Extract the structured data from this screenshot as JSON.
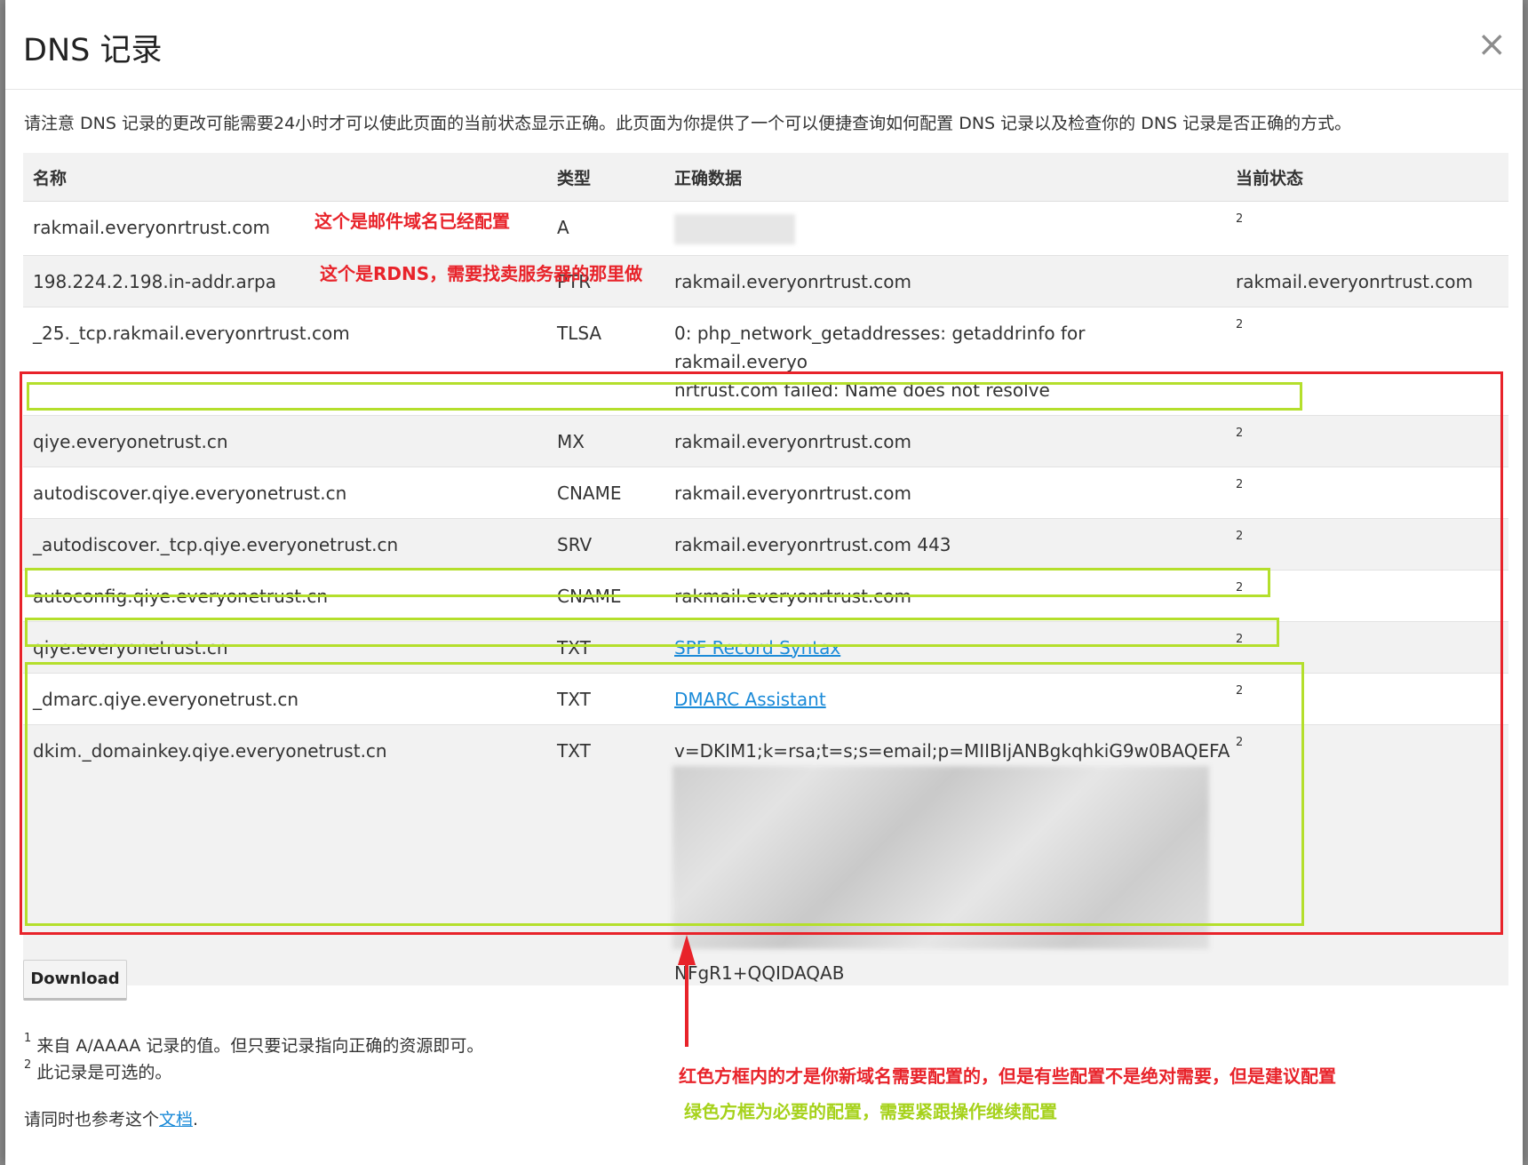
{
  "modal": {
    "title": "DNS 记录",
    "close_glyph": "×",
    "notice": "请注意 DNS 记录的更改可能需要24小时才可以使此页面的当前状态显示正确。此页面为你提供了一个可以便捷查询如何配置 DNS 记录以及检查你的 DNS 记录是否正确的方式。"
  },
  "table": {
    "headers": {
      "name": "名称",
      "type": "类型",
      "data": "正确数据",
      "status": "当前状态"
    },
    "rows": [
      {
        "name": "rakmail.everyonrtrust.com",
        "type": "A",
        "data": "",
        "status": "2"
      },
      {
        "name": "198.224.2.198.in-addr.arpa",
        "type": "PTR",
        "data": "rakmail.everyonrtrust.com",
        "status": "rakmail.everyonrtrust.com"
      },
      {
        "name": "_25._tcp.rakmail.everyonrtrust.com",
        "type": "TLSA",
        "data": "0: php_network_getaddresses: getaddrinfo for rakmail.everyo",
        "data2": "nrtrust.com failed: Name does not resolve",
        "status": "2"
      },
      {
        "name": "qiye.everyonetrust.cn",
        "type": "MX",
        "data": "rakmail.everyonrtrust.com",
        "status": "2"
      },
      {
        "name": "autodiscover.qiye.everyonetrust.cn",
        "type": "CNAME",
        "data": "rakmail.everyonrtrust.com",
        "status": "2"
      },
      {
        "name": "_autodiscover._tcp.qiye.everyonetrust.cn",
        "type": "SRV",
        "data": "rakmail.everyonrtrust.com 443",
        "status": "2"
      },
      {
        "name": "autoconfig.qiye.everyonetrust.cn",
        "type": "CNAME",
        "data": "rakmail.everyonrtrust.com",
        "status": "2"
      },
      {
        "name": "qiye.everyonetrust.cn",
        "type": "TXT",
        "data": "SPF Record Syntax",
        "status": "2"
      },
      {
        "name": "_dmarc.qiye.everyonetrust.cn",
        "type": "TXT",
        "data": "DMARC Assistant",
        "status": "2"
      },
      {
        "name": "dkim._domainkey.qiye.everyonetrust.cn",
        "type": "TXT",
        "data": "v=DKIM1;k=rsa;t=s;s=email;p=MIIBIjANBgkqhkiG9w0BAQEFA",
        "data_end": "NFgR1+QQIDAQAB",
        "status": "2"
      }
    ]
  },
  "download_label": "Download",
  "footnotes": {
    "note1_mark": "1",
    "note1": "来自 A/AAAA 记录的值。但只要记录指向正确的资源即可。",
    "note2_mark": "2",
    "note2": "此记录是可选的。",
    "docs_prefix": "请同时也参考这个",
    "docs_link": "文档",
    "docs_suffix": "."
  },
  "annotations": {
    "a_record": "这个是邮件域名已经配置",
    "rdns": "这个是RDNS，需要找卖服务器的那里做",
    "red_box": "红色方框内的才是你新域名需要配置的，但是有些配置不是绝对需要，但是建议配置",
    "green_box": "绿色方框为必要的配置，需要紧跟操作继续配置"
  },
  "colors": {
    "annotation_red": "#e8232a",
    "annotation_green": "#b4df2c",
    "link": "#1a8ad8"
  }
}
